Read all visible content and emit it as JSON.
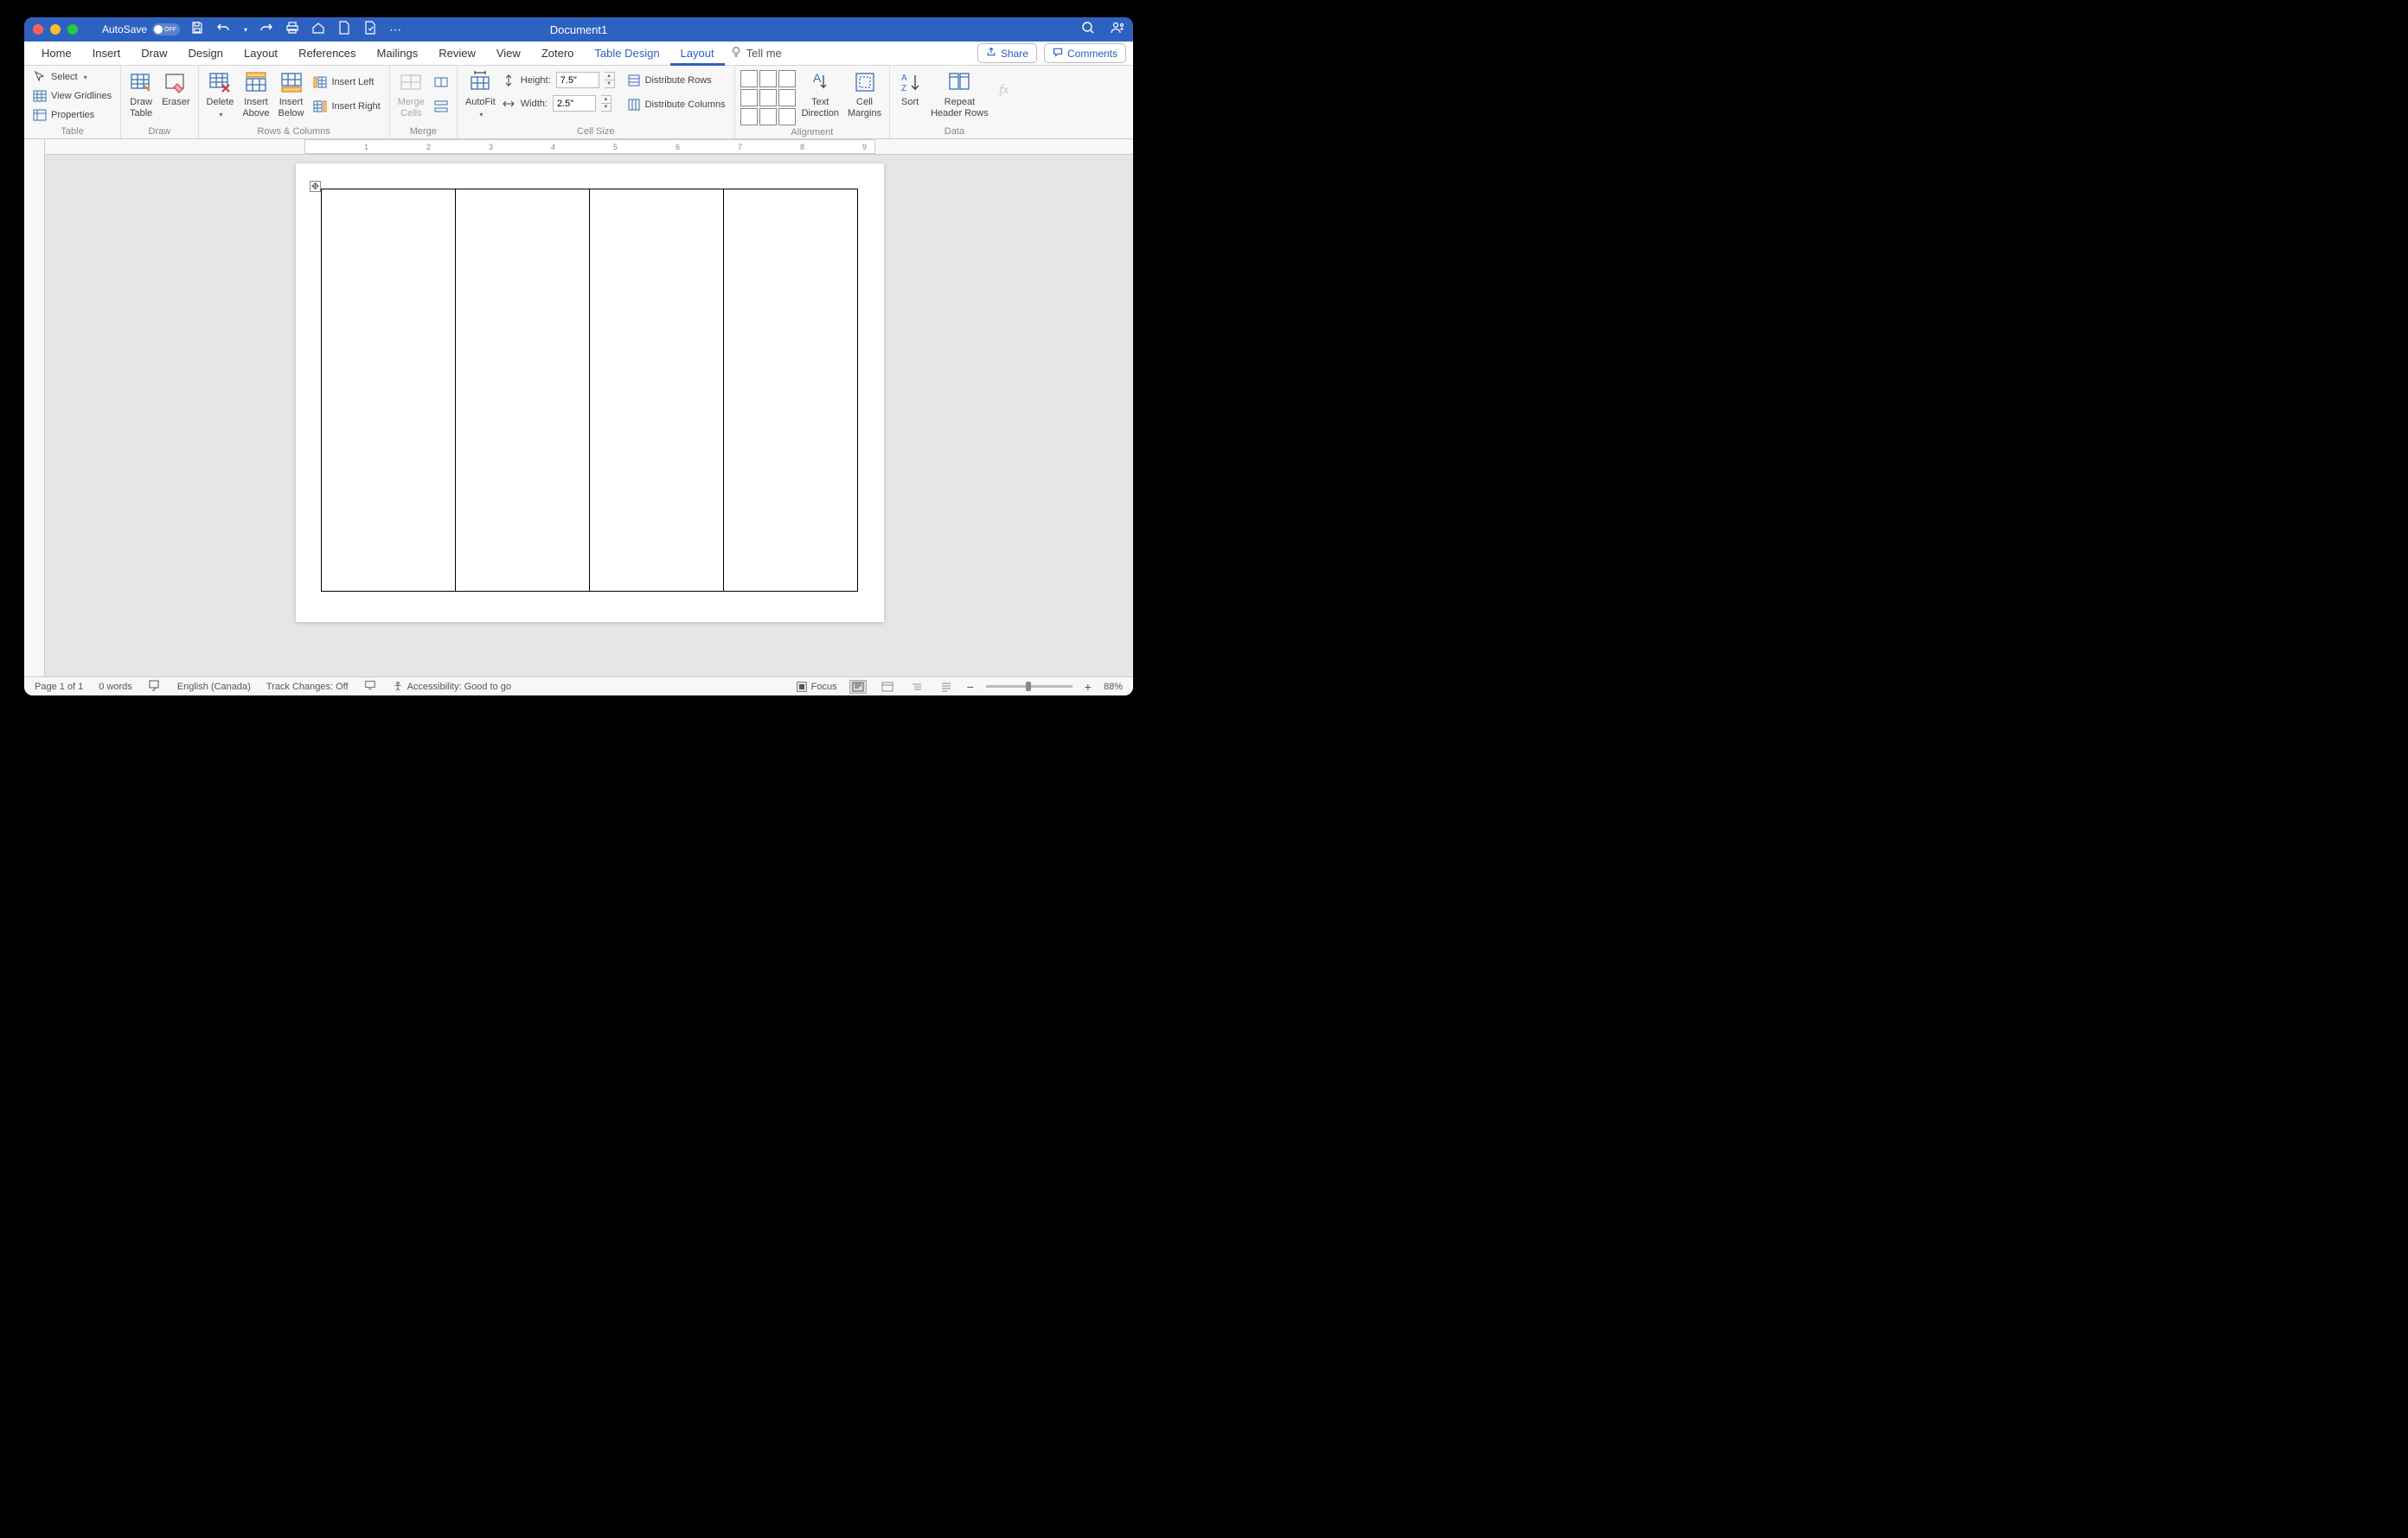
{
  "title": "Document1",
  "autosave": "AutoSave",
  "tabs": [
    "Home",
    "Insert",
    "Draw",
    "Design",
    "Layout",
    "References",
    "Mailings",
    "Review",
    "View",
    "Zotero",
    "Table Design",
    "Layout"
  ],
  "tellme": "Tell me",
  "share": "Share",
  "comments": "Comments",
  "ribbon": {
    "table": {
      "select": "Select",
      "gridlines": "View Gridlines",
      "properties": "Properties",
      "label": "Table"
    },
    "draw": {
      "drawtable": "Draw\nTable",
      "eraser": "Eraser",
      "label": "Draw"
    },
    "rowscols": {
      "delete": "Delete",
      "insabove": "Insert\nAbove",
      "insbelow": "Insert\nBelow",
      "insleft": "Insert Left",
      "insright": "Insert Right",
      "label": "Rows & Columns"
    },
    "merge": {
      "merge": "Merge\nCells",
      "split": "Split Cells",
      "splittbl": "Split Table",
      "label": "Merge"
    },
    "cellsize": {
      "autofit": "AutoFit",
      "height": "Height:",
      "width": "Width:",
      "hval": "7.5\"",
      "wval": "2.5\"",
      "distrows": "Distribute Rows",
      "distcols": "Distribute Columns",
      "label": "Cell Size"
    },
    "align": {
      "textdir": "Text\nDirection",
      "margins": "Cell\nMargins",
      "label": "Alignment"
    },
    "data": {
      "sort": "Sort",
      "repeat": "Repeat\nHeader Rows",
      "formula": "Formula",
      "label": "Data"
    }
  },
  "ruler_numbers": [
    "1",
    "2",
    "3",
    "4",
    "5",
    "6",
    "7",
    "8",
    "9"
  ],
  "status": {
    "page": "Page 1 of 1",
    "words": "0 words",
    "lang": "English (Canada)",
    "track": "Track Changes: Off",
    "access": "Accessibility: Good to go",
    "focus": "Focus",
    "zoom": "88%"
  }
}
